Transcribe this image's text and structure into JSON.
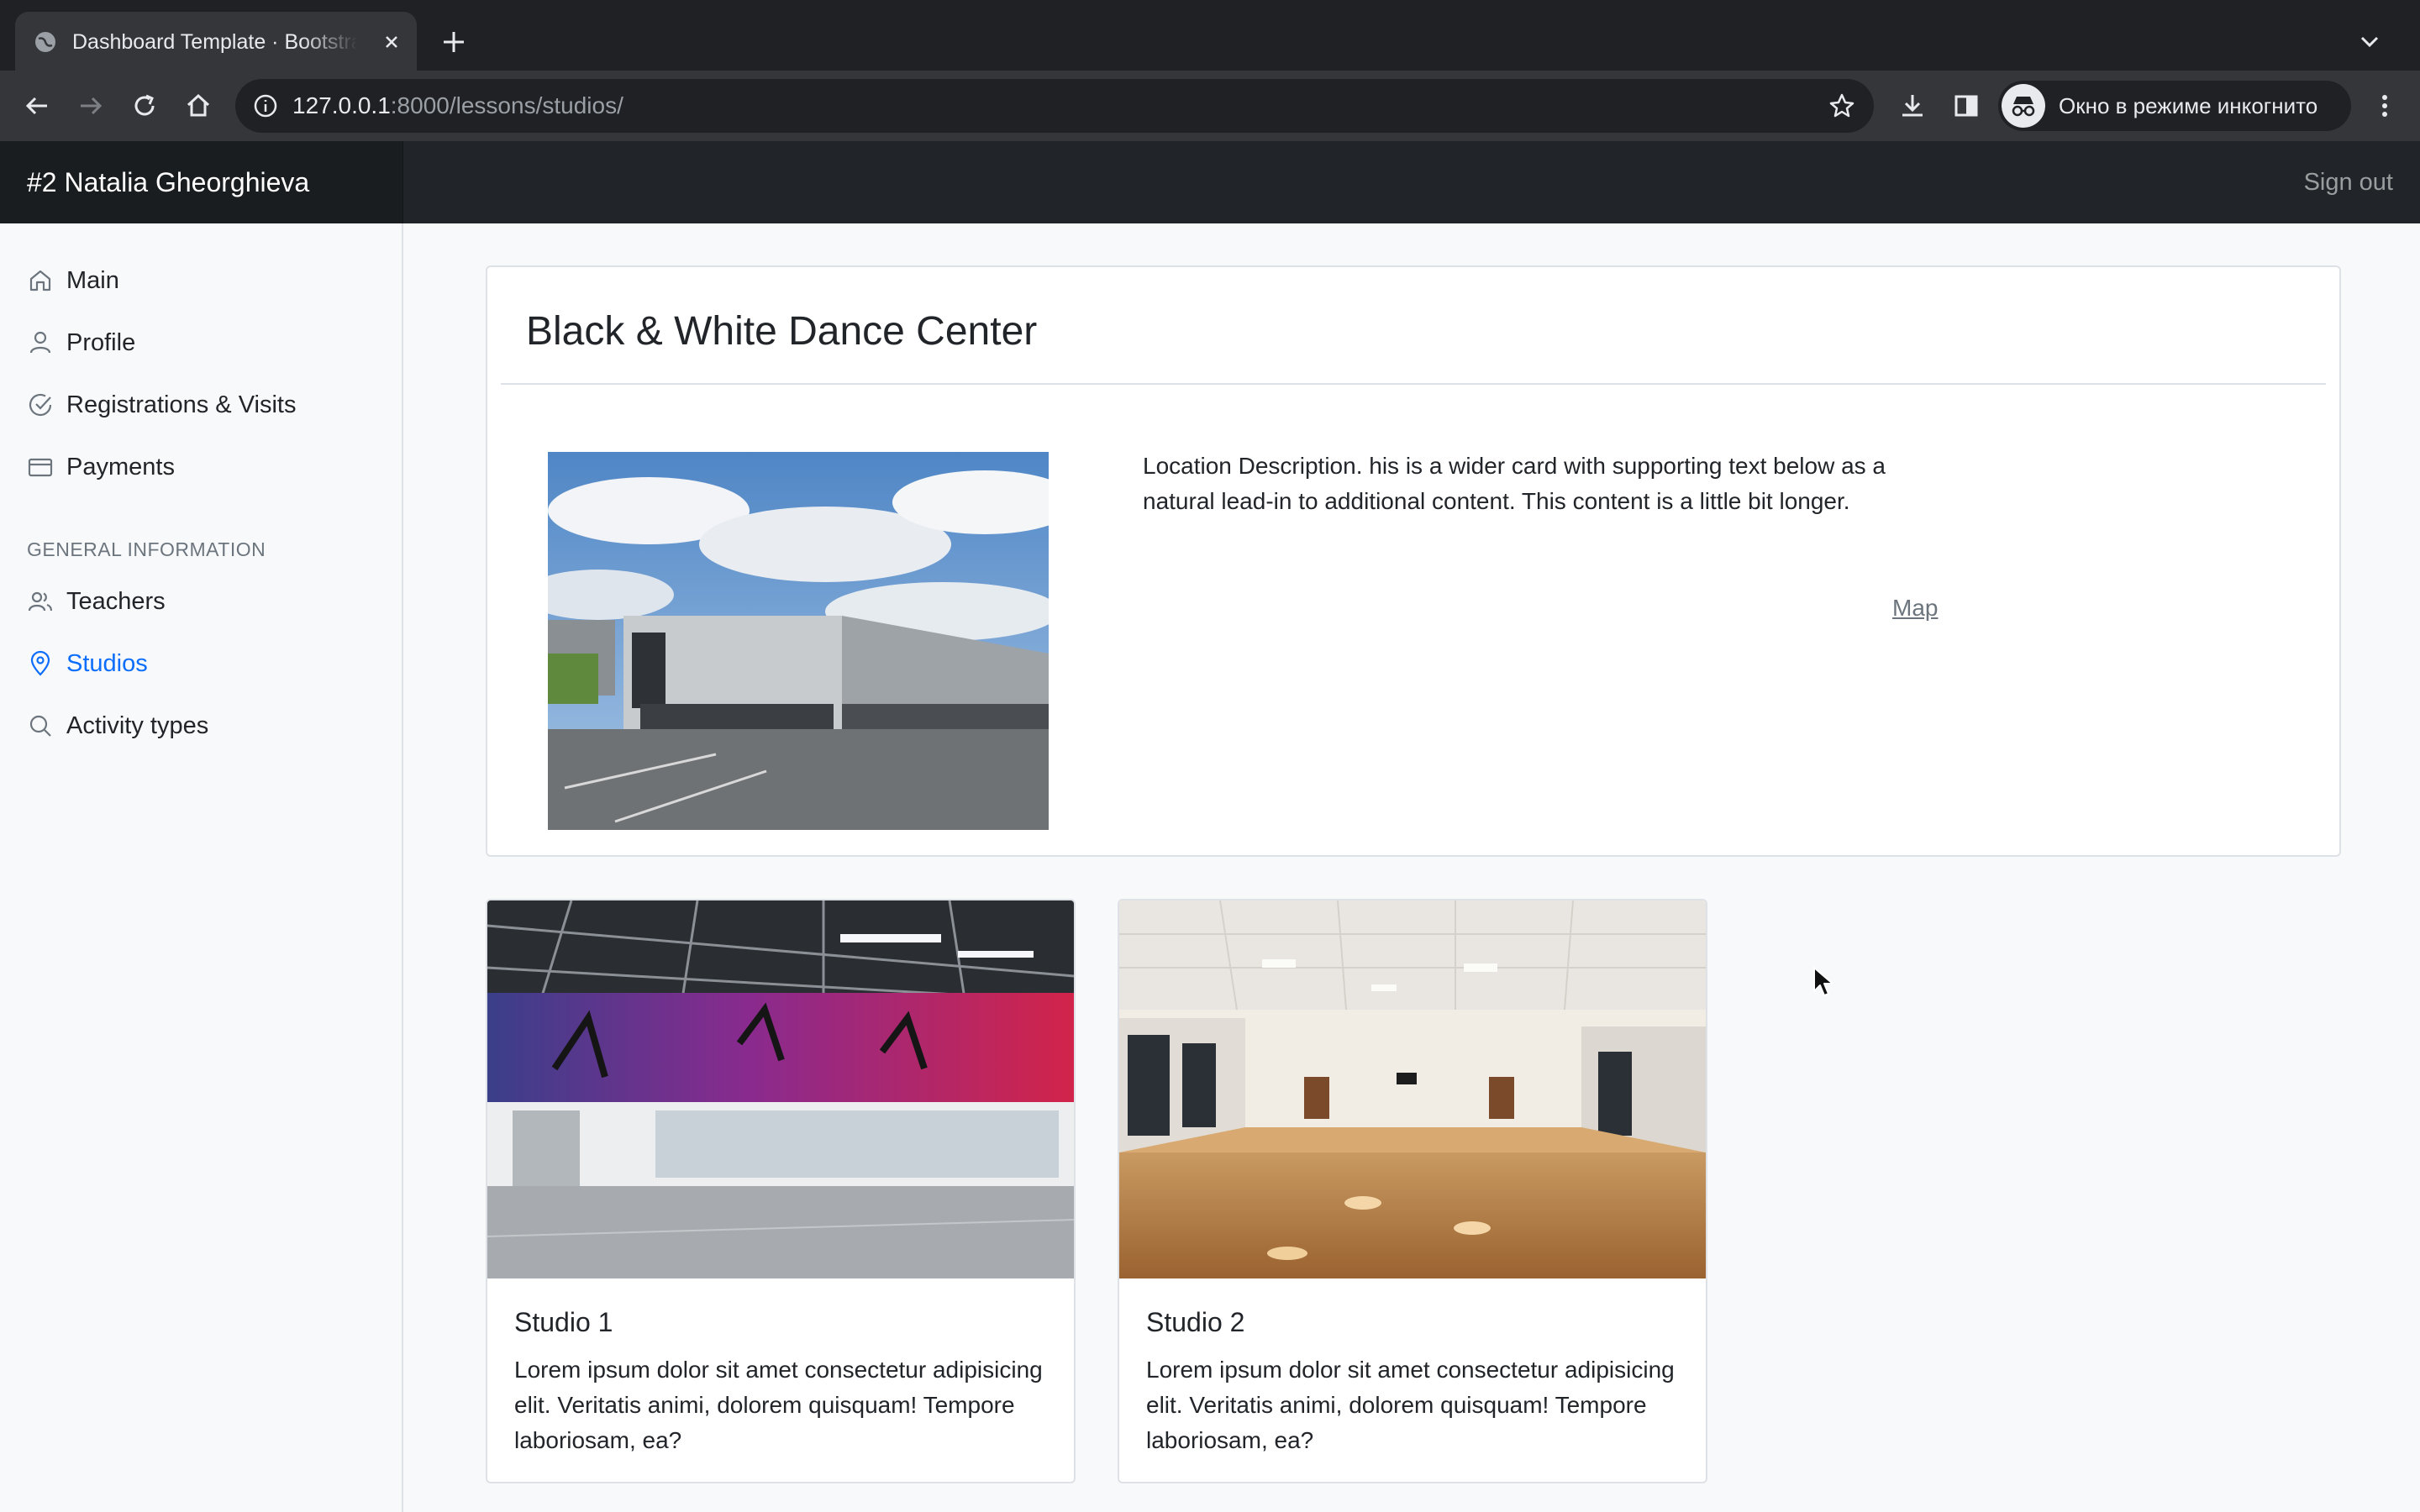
{
  "browser": {
    "tab_title": "Dashboard Template · Bootstrap",
    "url_host": "127.0.0.1",
    "url_rest": ":8000/lessons/studios/",
    "incognito_label": "Окно в режиме инкогнито"
  },
  "header": {
    "brand": "#2 Natalia Gheorghieva",
    "signout": "Sign out"
  },
  "sidebar": {
    "items": [
      {
        "label": "Main",
        "icon": "home-icon"
      },
      {
        "label": "Profile",
        "icon": "user-icon"
      },
      {
        "label": "Registrations & Visits",
        "icon": "check-circle-icon"
      },
      {
        "label": "Payments",
        "icon": "credit-card-icon"
      }
    ],
    "section_heading": "GENERAL INFORMATION",
    "section_items": [
      {
        "label": "Teachers",
        "icon": "users-icon"
      },
      {
        "label": "Studios",
        "icon": "map-pin-icon",
        "active": true
      },
      {
        "label": "Activity types",
        "icon": "search-icon"
      }
    ]
  },
  "location": {
    "title": "Black & White Dance Center",
    "description": "Location Description. his is a wider card with supporting text below as a natural lead-in to additional content. This content is a little bit longer.",
    "map_link": "Map"
  },
  "studios": [
    {
      "title": "Studio 1",
      "text": "Lorem ipsum dolor sit amet consectetur adipisicing elit. Veritatis animi, dolorem quisquam! Tempore laboriosam, ea?"
    },
    {
      "title": "Studio 2",
      "text": "Lorem ipsum dolor sit amet consectetur adipisicing elit. Veritatis animi, dolorem quisquam! Tempore laboriosam, ea?"
    }
  ],
  "colors": {
    "accent": "#0d6efd",
    "header_bg": "#212529",
    "sidebar_bg": "#f8f9fa",
    "muted": "#6c757d"
  }
}
